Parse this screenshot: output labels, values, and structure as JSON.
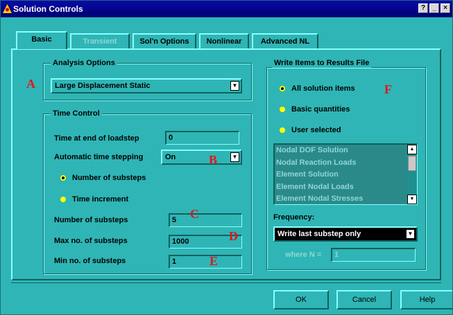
{
  "window": {
    "title": "Solution Controls"
  },
  "tabs": [
    {
      "label": "Basic",
      "state": "active"
    },
    {
      "label": "Transient",
      "state": "disabled"
    },
    {
      "label": "Sol'n Options",
      "state": "normal"
    },
    {
      "label": "Nonlinear",
      "state": "normal"
    },
    {
      "label": "Advanced NL",
      "state": "normal"
    }
  ],
  "analysis": {
    "group_label": "Analysis Options",
    "selected": "Large Displacement Static"
  },
  "time_control": {
    "group_label": "Time Control",
    "time_end_label": "Time at end of loadstep",
    "time_end_value": "0",
    "auto_step_label": "Automatic time stepping",
    "auto_step_value": "On",
    "radio_substeps": "Number of substeps",
    "radio_increment": "Time increment",
    "num_substeps_label": "Number of substeps",
    "num_substeps_value": "5",
    "max_substeps_label": "Max no. of substeps",
    "max_substeps_value": "1000",
    "min_substeps_label": "Min no. of substeps",
    "min_substeps_value": "1"
  },
  "write_items": {
    "group_label": "Write Items to Results File",
    "radio_all": "All solution items",
    "radio_basic": "Basic quantities",
    "radio_user": "User selected",
    "list_items": [
      "Nodal DOF Solution",
      "Nodal Reaction Loads",
      "Element Solution",
      "Element Nodal Loads",
      "Element Nodal Stresses"
    ],
    "frequency_label": "Frequency:",
    "frequency_value": "Write last substep only",
    "where_label": "where N =",
    "where_value": "1"
  },
  "annotations": {
    "a": "A",
    "b": "B",
    "c": "C",
    "d": "D",
    "e": "E",
    "f": "F"
  },
  "buttons": {
    "ok": "OK",
    "cancel": "Cancel",
    "help": "Help"
  },
  "colors": {
    "background": "#2fb5b5",
    "titlebar": "#00008b",
    "annotation": "#e0161a",
    "radio": "#ffff00"
  }
}
